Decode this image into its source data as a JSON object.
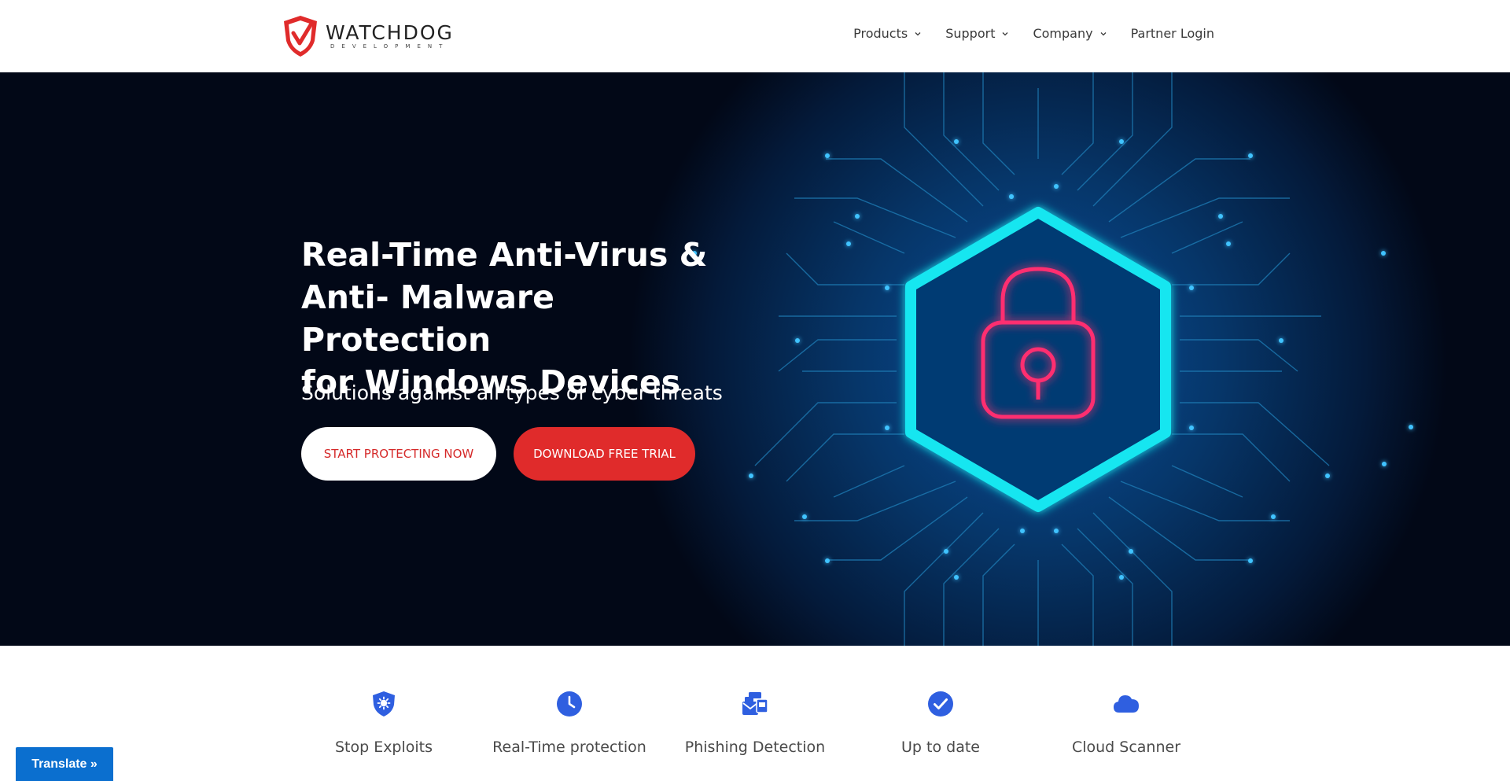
{
  "header": {
    "logo": {
      "name": "WATCHDOG",
      "tagline": "DEVELOPMENT"
    },
    "nav": [
      {
        "label": "Products",
        "has_dropdown": true
      },
      {
        "label": "Support",
        "has_dropdown": true
      },
      {
        "label": "Company",
        "has_dropdown": true
      },
      {
        "label": "Partner Login",
        "has_dropdown": false
      }
    ]
  },
  "hero": {
    "title_lines": [
      "Real-Time Anti-Virus &",
      "Anti- Malware Protection",
      "for Windows Devices"
    ],
    "subtitle": "Solutions against all types of cyber threats",
    "primary_button": "START PROTECTING NOW",
    "secondary_button": "DOWNLOAD FREE TRIAL",
    "illustration": "circuit-board-hexagon-padlock"
  },
  "features": [
    {
      "label": "Stop Exploits",
      "icon": "shield-virus-icon"
    },
    {
      "label": "Real-Time protection",
      "icon": "clock-icon"
    },
    {
      "label": "Phishing Detection",
      "icon": "mail-bulk-icon"
    },
    {
      "label": "Up to date",
      "icon": "check-circle-icon"
    },
    {
      "label": "Cloud Scanner",
      "icon": "cloud-icon"
    }
  ],
  "translate_label": "Translate »",
  "colors": {
    "brand_red": "#e02b2b",
    "hero_bg": "#020817",
    "feature_icon_blue": "#2f5fe0",
    "neon_cyan": "#19e6f0",
    "neon_pink": "#ff2d6f",
    "translate_blue": "#0b6fcf"
  }
}
